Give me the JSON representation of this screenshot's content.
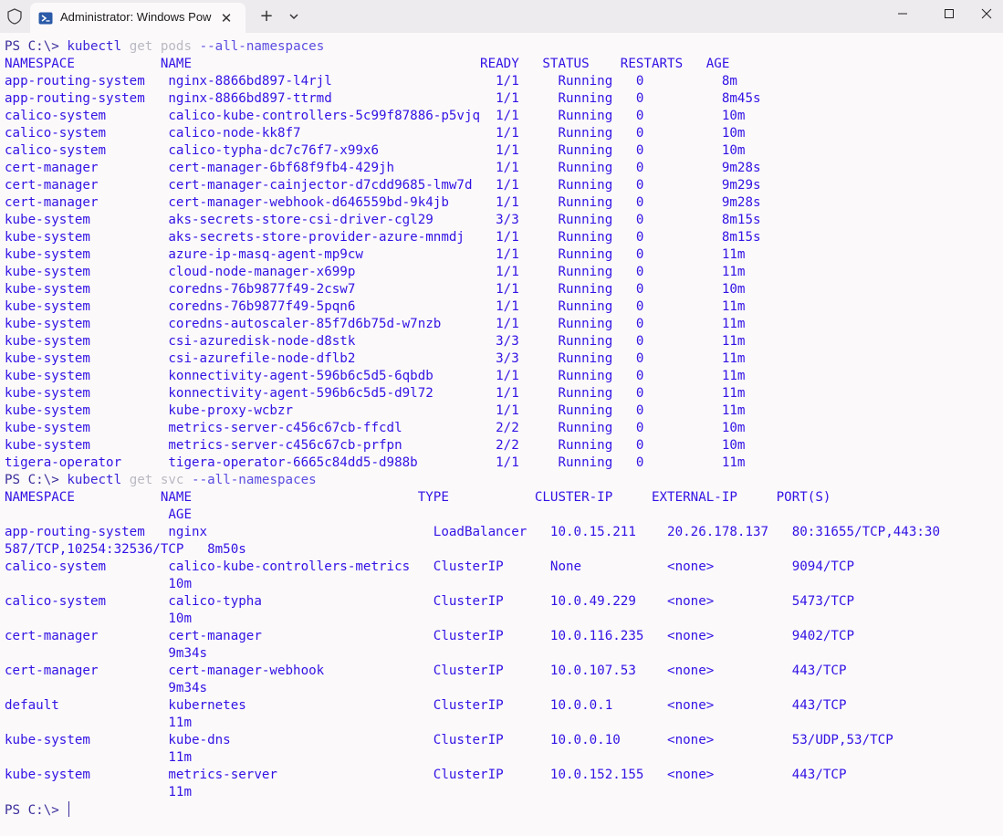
{
  "window": {
    "tab_title": "Administrator: Windows Powe",
    "close_tab_glyph": "✕",
    "new_tab_glyph": "+",
    "icons": [
      "shield-icon",
      "powershell-icon",
      "chevron-down-icon",
      "minimize-icon",
      "maximize-icon",
      "close-icon"
    ]
  },
  "colors": {
    "background": "#fcf9fb",
    "text": "#3113e4",
    "prompt": "#3a2e9a",
    "dim_argument": "#b9b9c1"
  },
  "terminal": {
    "prompt": "PS C:\\>",
    "command1": {
      "name": "kubectl",
      "sub": "get pods",
      "flag": "--all-namespaces"
    },
    "pods_header": "NAMESPACE           NAME                                     READY   STATUS    RESTARTS   AGE",
    "pods": [
      "app-routing-system   nginx-8866bd897-l4rjl                     1/1     Running   0          8m",
      "app-routing-system   nginx-8866bd897-ttrmd                     1/1     Running   0          8m45s",
      "calico-system        calico-kube-controllers-5c99f87886-p5vjq  1/1     Running   0          10m",
      "calico-system        calico-node-kk8f7                         1/1     Running   0          10m",
      "calico-system        calico-typha-dc7c76f7-x99x6               1/1     Running   0          10m",
      "cert-manager         cert-manager-6bf68f9fb4-429jh             1/1     Running   0          9m28s",
      "cert-manager         cert-manager-cainjector-d7cdd9685-lmw7d   1/1     Running   0          9m29s",
      "cert-manager         cert-manager-webhook-d646559bd-9k4jb      1/1     Running   0          9m28s",
      "kube-system          aks-secrets-store-csi-driver-cgl29        3/3     Running   0          8m15s",
      "kube-system          aks-secrets-store-provider-azure-mnmdj    1/1     Running   0          8m15s",
      "kube-system          azure-ip-masq-agent-mp9cw                 1/1     Running   0          11m",
      "kube-system          cloud-node-manager-x699p                  1/1     Running   0          11m",
      "kube-system          coredns-76b9877f49-2csw7                  1/1     Running   0          10m",
      "kube-system          coredns-76b9877f49-5pqn6                  1/1     Running   0          11m",
      "kube-system          coredns-autoscaler-85f7d6b75d-w7nzb       1/1     Running   0          11m",
      "kube-system          csi-azuredisk-node-d8stk                  3/3     Running   0          11m",
      "kube-system          csi-azurefile-node-dflb2                  3/3     Running   0          11m",
      "kube-system          konnectivity-agent-596b6c5d5-6qbdb        1/1     Running   0          11m",
      "kube-system          konnectivity-agent-596b6c5d5-d9l72        1/1     Running   0          11m",
      "kube-system          kube-proxy-wcbzr                          1/1     Running   0          11m",
      "kube-system          metrics-server-c456c67cb-ffcdl            2/2     Running   0          10m",
      "kube-system          metrics-server-c456c67cb-prfpn            2/2     Running   0          10m",
      "tigera-operator      tigera-operator-6665c84dd5-d988b          1/1     Running   0          11m"
    ],
    "command2": {
      "name": "kubectl",
      "sub": "get svc",
      "flag": "--all-namespaces"
    },
    "svc_header": "NAMESPACE           NAME                             TYPE           CLUSTER-IP     EXTERNAL-IP     PORT(S)",
    "svc_header_wrap": "                     AGE",
    "services": [
      "app-routing-system   nginx                             LoadBalancer   10.0.15.211    20.26.178.137   80:31655/TCP,443:30",
      "587/TCP,10254:32536/TCP   8m50s",
      "calico-system        calico-kube-controllers-metrics   ClusterIP      None           <none>          9094/TCP",
      "                     10m",
      "calico-system        calico-typha                      ClusterIP      10.0.49.229    <none>          5473/TCP",
      "                     10m",
      "cert-manager         cert-manager                      ClusterIP      10.0.116.235   <none>          9402/TCP",
      "                     9m34s",
      "cert-manager         cert-manager-webhook              ClusterIP      10.0.107.53    <none>          443/TCP",
      "                     9m34s",
      "default              kubernetes                        ClusterIP      10.0.0.1       <none>          443/TCP",
      "                     11m",
      "kube-system          kube-dns                          ClusterIP      10.0.0.10      <none>          53/UDP,53/TCP",
      "                     11m",
      "kube-system          metrics-server                    ClusterIP      10.0.152.155   <none>          443/TCP",
      "                     11m"
    ],
    "final_prompt": "PS C:\\>"
  }
}
